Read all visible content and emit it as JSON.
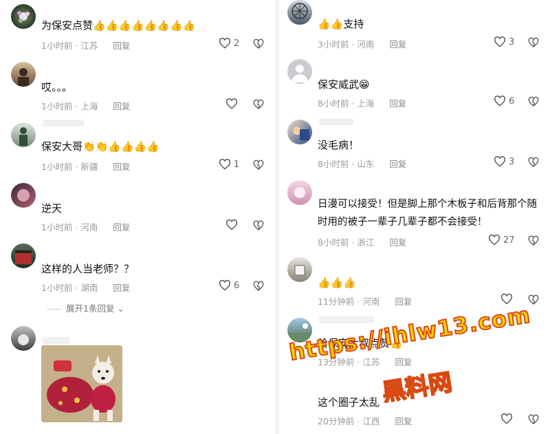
{
  "left_comments": [
    {
      "text": "为保安点赞",
      "emoji_count": 8,
      "emoji": "👍",
      "time": "1小时前",
      "location": "江苏",
      "reply": "回复",
      "likes": "2"
    },
    {
      "text": "哎。。。",
      "time": "1小时前",
      "location": "上海",
      "reply": "回复",
      "likes": ""
    },
    {
      "text": "保安大哥",
      "time": "1小时前",
      "location": "新疆",
      "reply": "回复",
      "likes": "1"
    },
    {
      "text": "逆天",
      "time": "1小时前",
      "location": "河南",
      "reply": "回复",
      "likes": ""
    },
    {
      "text": "这样的人当老师？？",
      "time": "1小时前",
      "location": "湖南",
      "reply": "回复",
      "likes": "6"
    }
  ],
  "expand_label": "展开1条回复",
  "right_comments": [
    {
      "text": "支持",
      "time": "3小时前",
      "location": "河南",
      "reply": "回复",
      "likes": "3"
    },
    {
      "text": "保安威武",
      "time": "8小时前",
      "location": "上海",
      "reply": "回复",
      "likes": "6"
    },
    {
      "text": "没毛病！",
      "time": "8小时前",
      "location": "山东",
      "reply": "回复",
      "likes": "3"
    },
    {
      "text": "日漫可以接受！但是脚上那个木板子和后背那个随时用的被子一辈子几辈子都不会接受！",
      "time": "8小时前",
      "location": "浙江",
      "reply": "回复",
      "likes": "27"
    },
    {
      "text": "",
      "time": "11分钟前",
      "location": "河南",
      "reply": "回复",
      "likes": ""
    },
    {
      "text": "给保安大叔点赞",
      "time": "13分钟前",
      "location": "江苏",
      "reply": "回复",
      "likes": ""
    },
    {
      "text": "这个圈子太乱",
      "time": "20分钟前",
      "location": "江西",
      "reply": "回复",
      "likes": ""
    }
  ],
  "watermark": {
    "url": "https://ihlw13.com",
    "name": "黑料网"
  },
  "colors": {
    "meta_text": "#9a9a9a",
    "watermark_fill": "#ffd400",
    "watermark_stroke": "#d84a12"
  }
}
